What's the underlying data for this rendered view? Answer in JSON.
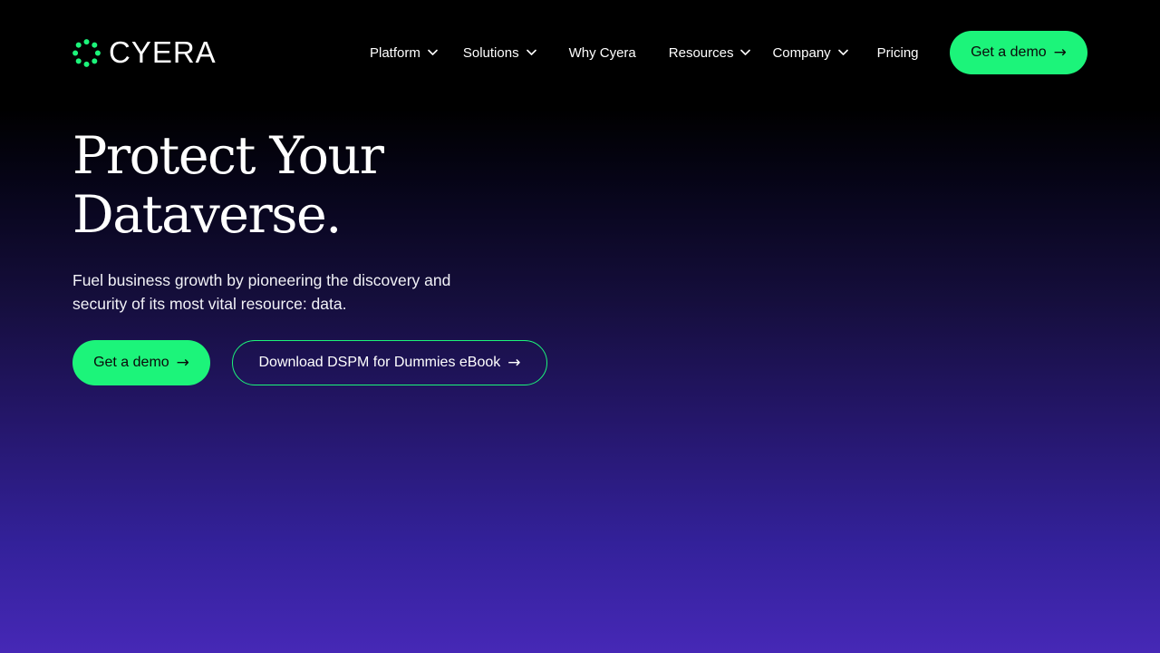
{
  "brand": {
    "name": "CYERA",
    "logo_icon": "cyera-ring-logo-icon",
    "accent_color": "#1cf47a"
  },
  "nav": {
    "items": [
      {
        "label": "Platform",
        "has_dropdown": true
      },
      {
        "label": "Solutions",
        "has_dropdown": true
      },
      {
        "label": "Why Cyera",
        "has_dropdown": false
      },
      {
        "label": "Resources",
        "has_dropdown": true
      },
      {
        "label": "Company",
        "has_dropdown": true
      },
      {
        "label": "Pricing",
        "has_dropdown": false
      }
    ],
    "dropdown_icon": "chevron-down-icon",
    "cta_label": "Get a demo",
    "cta_icon": "arrow-right-icon"
  },
  "hero": {
    "title_line1": "Protect Your",
    "title_line2": "Dataverse.",
    "subtitle": "Fuel business growth by pioneering the discovery and security of its most vital resource: data.",
    "primary_cta": "Get a demo",
    "secondary_cta": "Download DSPM for Dummies eBook",
    "arrow_glyph": "→"
  },
  "colors": {
    "background_top": "#000000",
    "background_bottom": "#4628b6",
    "button_text": "#0a0a0a"
  }
}
